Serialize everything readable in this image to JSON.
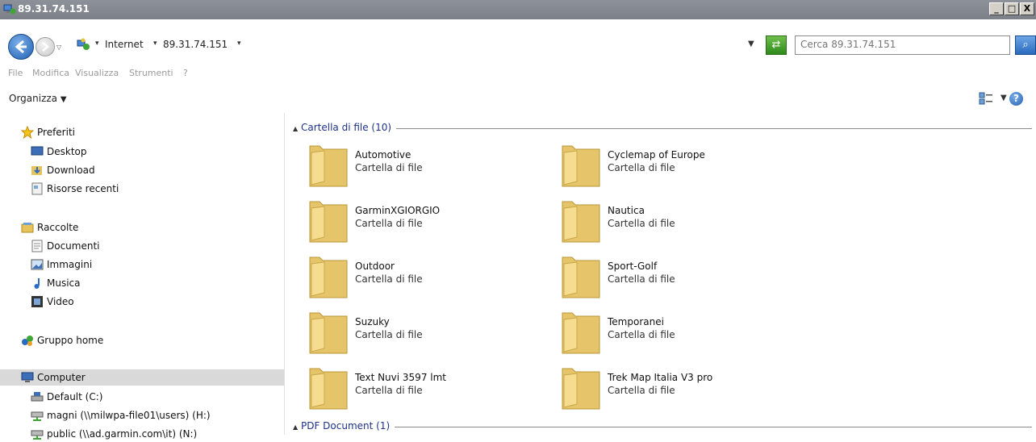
{
  "window": {
    "title": "89.31.74.151",
    "minimize": "_",
    "maximize": "□",
    "close": "X"
  },
  "address": {
    "segments": [
      "Internet",
      "89.31.74.151"
    ],
    "search_placeholder": "Cerca 89.31.74.151"
  },
  "menu": [
    "File",
    "Modifica",
    "Visualizza",
    "Strumenti",
    "?"
  ],
  "command_bar": {
    "organize": "Organizza",
    "help": "?"
  },
  "sidebar": {
    "favorites": {
      "label": "Preferiti",
      "items": [
        "Desktop",
        "Download",
        "Risorse recenti"
      ]
    },
    "libraries": {
      "label": "Raccolte",
      "items": [
        "Documenti",
        "Immagini",
        "Musica",
        "Video"
      ]
    },
    "homegroup": "Gruppo home",
    "computer": {
      "label": "Computer",
      "items": [
        "Default (C:)",
        "magni (\\\\milwpa-file01\\users) (H:)",
        "public (\\\\ad.garmin.com\\it) (N:)"
      ]
    }
  },
  "content": {
    "groups": [
      {
        "label": "Cartella di file (10)",
        "items": [
          {
            "name": "Automotive",
            "type": "Cartella di file"
          },
          {
            "name": "Cyclemap of Europe",
            "type": "Cartella di file"
          },
          {
            "name": "GarminXGIORGIO",
            "type": "Cartella di file"
          },
          {
            "name": "Nautica",
            "type": "Cartella di file"
          },
          {
            "name": "Outdoor",
            "type": "Cartella di file"
          },
          {
            "name": "Sport-Golf",
            "type": "Cartella di file"
          },
          {
            "name": "Suzuky",
            "type": "Cartella di file"
          },
          {
            "name": "Temporanei",
            "type": "Cartella di file"
          },
          {
            "name": "Text Nuvi 3597 lmt",
            "type": "Cartella di file"
          },
          {
            "name": "Trek Map Italia V3 pro",
            "type": "Cartella di file"
          }
        ]
      },
      {
        "label": "PDF Document (1)",
        "items": []
      }
    ]
  }
}
